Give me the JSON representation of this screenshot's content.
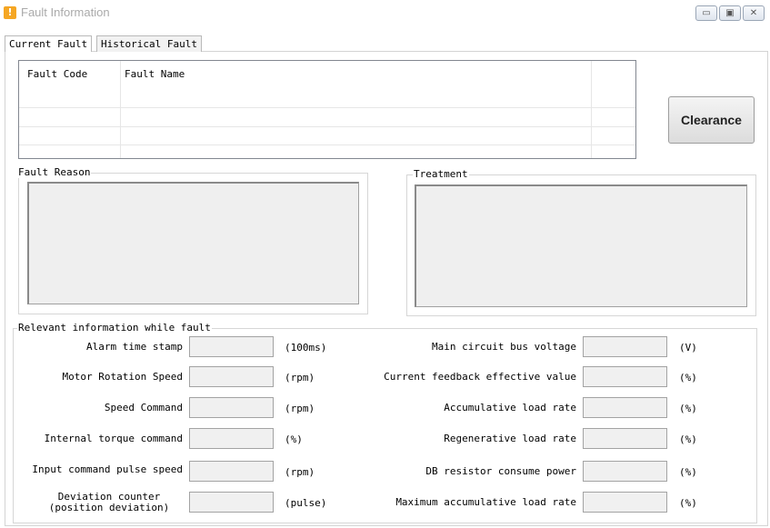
{
  "window": {
    "title": "Fault Information",
    "app_icon": "!",
    "minimize_glyph": "▭",
    "maximize_glyph": "▣",
    "close_glyph": "✕"
  },
  "tabs": [
    "Current Fault",
    "Historical Fault"
  ],
  "fault_table": {
    "columns": [
      "Fault Code",
      "Fault Name"
    ],
    "rows": []
  },
  "clearance_label": "Clearance",
  "fault_reason": {
    "label": "Fault Reason",
    "value": ""
  },
  "treatment": {
    "label": "Treatment",
    "value": ""
  },
  "info": {
    "label": "Relevant information while fault",
    "left": [
      {
        "label": "Alarm time stamp",
        "value": "",
        "unit": "(100ms)"
      },
      {
        "label": "Motor Rotation Speed",
        "value": "",
        "unit": "(rpm)"
      },
      {
        "label": "Speed Command",
        "value": "",
        "unit": "(rpm)"
      },
      {
        "label": "Internal torque command",
        "value": "",
        "unit": "(%)"
      },
      {
        "label": "Input command pulse speed",
        "value": "",
        "unit": "(rpm)"
      },
      {
        "label_line1": "Deviation counter",
        "label_line2": "(position deviation)",
        "value": "",
        "unit": "(pulse)"
      }
    ],
    "right": [
      {
        "label": "Main circuit bus voltage",
        "value": "",
        "unit": "(V)"
      },
      {
        "label": "Current feedback effective value",
        "value": "",
        "unit": "(%)"
      },
      {
        "label": "Accumulative load rate",
        "value": "",
        "unit": "(%)"
      },
      {
        "label": "Regenerative load rate",
        "value": "",
        "unit": "(%)"
      },
      {
        "label": "DB resistor consume power",
        "value": "",
        "unit": "(%)"
      },
      {
        "label": "Maximum accumulative load rate",
        "value": "",
        "unit": "(%)"
      }
    ]
  }
}
